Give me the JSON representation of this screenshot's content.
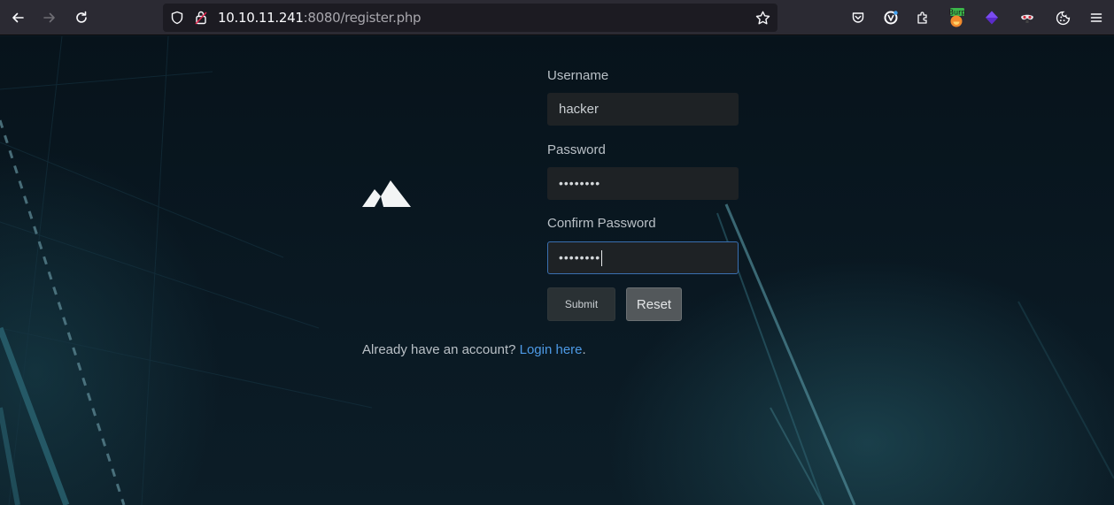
{
  "browser": {
    "url_host": "10.10.11.241",
    "url_rest": ":8080/register.php",
    "extensions": {
      "burp_badge": "Burp"
    },
    "icons": [
      "back-arrow-icon",
      "forward-arrow-icon",
      "reload-icon",
      "shield-icon",
      "lock-icon",
      "bookmark-star-icon",
      "pocket-icon",
      "account-icon",
      "extensions-icon",
      "burp-extension-icon",
      "cube-extension-icon",
      "mask-extension-icon",
      "cookie-icon",
      "menu-icon"
    ]
  },
  "form": {
    "username_label": "Username",
    "username_value": "hacker",
    "password_label": "Password",
    "password_value": "••••••••",
    "confirm_label": "Confirm Password",
    "confirm_value": "••••••••",
    "submit_label": "Submit",
    "reset_label": "Reset"
  },
  "footer": {
    "prompt": "Already have an account?",
    "login_link": "Login here",
    "suffix": "."
  },
  "colors": {
    "background": "#0a1822",
    "link": "#4d9ae6",
    "focus_border": "#3a6fb0"
  }
}
